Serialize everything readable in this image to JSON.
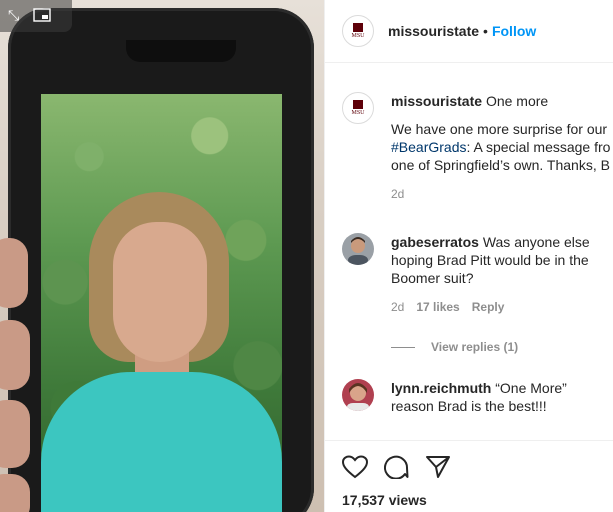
{
  "post": {
    "account": "missouristate",
    "follow_label": "Follow",
    "separator": "•",
    "logo_text": "Missouri State"
  },
  "caption": {
    "user": "missouristate",
    "text_first": "One more",
    "line1": "We have one more surprise for our",
    "hashtag": "#BearGrads",
    "line2_rest": ": A special message fro",
    "line3": "one of Springfield’s own. Thanks, B",
    "time": "2d"
  },
  "comments": [
    {
      "user": "gabeserratos",
      "text": "Was anyone else hoping Brad Pitt would be in the Boomer suit?",
      "time": "2d",
      "likes": "17 likes",
      "reply_label": "Reply",
      "view_replies": "View replies (1)"
    },
    {
      "user": "lynn.reichmuth",
      "text": "“One More” reason Brad is the best!!!"
    }
  ],
  "actions": {
    "like_icon": "heart-icon",
    "comment_icon": "comment-icon",
    "share_icon": "paper-plane-icon",
    "views": "17,537 views"
  },
  "media_controls": {
    "expand_icon": "expand-icon",
    "pip_icon": "picture-in-picture-icon"
  },
  "colors": {
    "follow": "#0095f6",
    "hashtag": "#00376b",
    "muted": "#8e8e8e",
    "brand": "#5e0009"
  }
}
